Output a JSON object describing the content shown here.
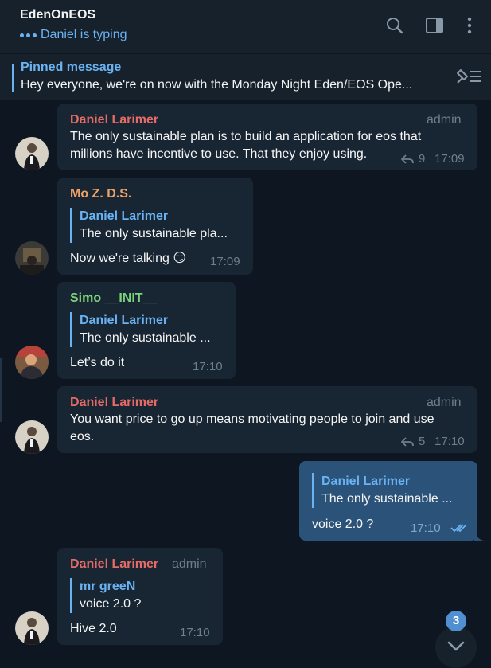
{
  "header": {
    "title": "EdenOnEOS",
    "status": "Daniel is typing",
    "icons": [
      "search-icon",
      "sidebar-panel-icon",
      "more-vertical-icon"
    ]
  },
  "pinned": {
    "title": "Pinned message",
    "text": "Hey everyone, we're on now with the Monday Night Eden/EOS Ope...",
    "icon": "unpin-list-icon"
  },
  "messages": [
    {
      "sender": "Daniel Larimer",
      "role": "admin",
      "text_line1": "The only sustainable plan is to build an application for eos that",
      "text_line2": "millions have incentive to use. That they enjoy using.",
      "replies": "9",
      "time": "17:09"
    },
    {
      "sender": "Mo Z. D.S.",
      "quote_name": "Daniel Larimer",
      "quote_text": "The only sustainable pla...",
      "text": "Now we're talking 😏",
      "time": "17:09"
    },
    {
      "sender": "Simo __INIT__",
      "quote_name": "Daniel Larimer",
      "quote_text": "The only sustainable ...",
      "text": "Let’s do it",
      "time": "17:10"
    },
    {
      "sender": "Daniel Larimer",
      "role": "admin",
      "text_line1": "You want price to go up means motivating people to join and use",
      "text_line2": "eos.",
      "replies": "5",
      "time": "17:10"
    },
    {
      "quote_name": "Daniel Larimer",
      "quote_text": "The only sustainable ...",
      "text": "voice 2.0 ?",
      "time": "17:10",
      "status": "read"
    },
    {
      "sender": "Daniel Larimer",
      "role": "admin",
      "quote_name": "mr greeN",
      "quote_text": "voice 2.0 ?",
      "text": "Hive 2.0",
      "time": "17:10"
    }
  ],
  "scroll": {
    "unread_count": "3"
  },
  "colors": {
    "background": "#0e1621",
    "header": "#17212b",
    "bubble_in": "#182533",
    "bubble_out": "#2b5278",
    "accent": "#6ab3f3",
    "name_red": "#e66b66",
    "name_orange": "#f0a264",
    "name_green": "#7bd47b"
  }
}
